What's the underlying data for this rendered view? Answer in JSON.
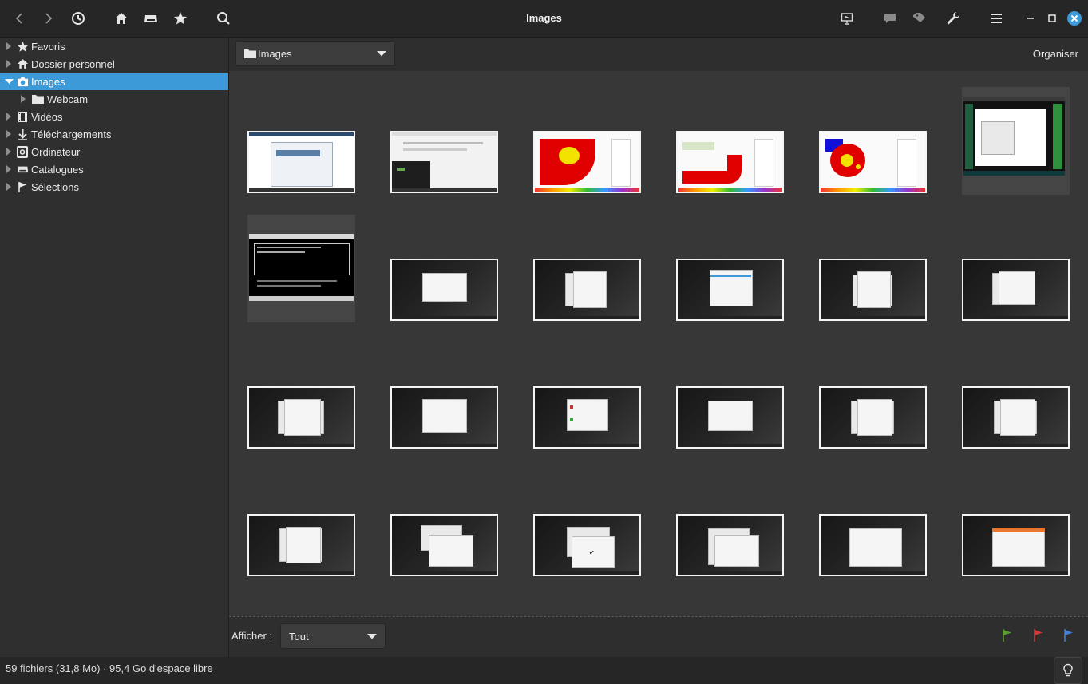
{
  "window": {
    "title": "Images"
  },
  "toolbar_icons": [
    "back-icon",
    "forward-icon",
    "history-icon",
    "home-icon",
    "drive-icon",
    "star-icon",
    "search-icon",
    "slideshow-icon",
    "comment-icon",
    "tag-icon",
    "wrench-icon",
    "menu-icon",
    "minimize-icon",
    "maximize-icon",
    "close-icon"
  ],
  "sidebar": {
    "items": [
      {
        "label": "Favoris",
        "icon": "star-icon",
        "level": 0,
        "expanded": false,
        "selected": false
      },
      {
        "label": "Dossier personnel",
        "icon": "home-icon",
        "level": 0,
        "expanded": false,
        "selected": false
      },
      {
        "label": "Images",
        "icon": "camera-icon",
        "level": 0,
        "expanded": true,
        "selected": true
      },
      {
        "label": "Webcam",
        "icon": "folder-icon",
        "level": 1,
        "expanded": false,
        "selected": false
      },
      {
        "label": "Vidéos",
        "icon": "film-icon",
        "level": 0,
        "expanded": false,
        "selected": false
      },
      {
        "label": "Téléchargements",
        "icon": "download-icon",
        "level": 0,
        "expanded": false,
        "selected": false
      },
      {
        "label": "Ordinateur",
        "icon": "computer-icon",
        "level": 0,
        "expanded": false,
        "selected": false
      },
      {
        "label": "Catalogues",
        "icon": "archive-icon",
        "level": 0,
        "expanded": false,
        "selected": false
      },
      {
        "label": "Sélections",
        "icon": "flag-icon",
        "level": 0,
        "expanded": false,
        "selected": false
      }
    ]
  },
  "location": {
    "folder": "Images",
    "organize_label": "Organiser"
  },
  "filter": {
    "label": "Afficher :",
    "value": "Tout"
  },
  "flags": {
    "green": "#5aa02c",
    "red": "#d23a3a",
    "blue": "#3f7fd6"
  },
  "status": {
    "text": "59 fichiers (31,8 Mo) · 95,4 Go d'espace libre"
  },
  "colors": {
    "accent": "#3d9ad8",
    "close": "#3d9ad8"
  }
}
